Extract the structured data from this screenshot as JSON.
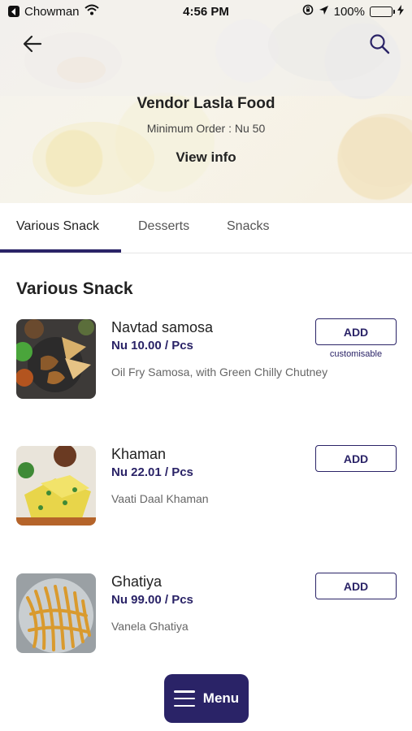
{
  "status_bar": {
    "carrier": "Chowman",
    "time": "4:56 PM",
    "battery_percent": "100%",
    "icons": [
      "back-app-icon",
      "wifi-icon",
      "orientation-lock-icon",
      "location-arrow-icon",
      "battery-icon",
      "charging-icon"
    ]
  },
  "header": {
    "back_icon": "arrow-left-icon",
    "search_icon": "search-icon",
    "vendor_name": "Vendor Lasla Food",
    "min_order": "Minimum Order : Nu 50",
    "view_info_label": "View info"
  },
  "tabs": [
    {
      "label": "Various Snack",
      "active": true
    },
    {
      "label": "Desserts",
      "active": false
    },
    {
      "label": "Snacks",
      "active": false
    }
  ],
  "section": {
    "title": "Various Snack",
    "items": [
      {
        "name": "Navtad samosa",
        "price": "Nu 10.00  / Pcs",
        "description": "Oil Fry Samosa, with Green Chilly Chutney",
        "add_label": "ADD",
        "customisable_note": "customisable"
      },
      {
        "name": "Khaman",
        "price": "Nu 22.01  / Pcs",
        "description": "Vaati Daal Khaman",
        "add_label": "ADD"
      },
      {
        "name": "Ghatiya",
        "price": "Nu 99.00  / Pcs",
        "description": "Vanela Ghatiya",
        "add_label": "ADD"
      }
    ]
  },
  "menu_button": {
    "label": "Menu",
    "icon": "hamburger-icon"
  },
  "colors": {
    "accent": "#2a2367",
    "battery": "#2ecc40"
  }
}
